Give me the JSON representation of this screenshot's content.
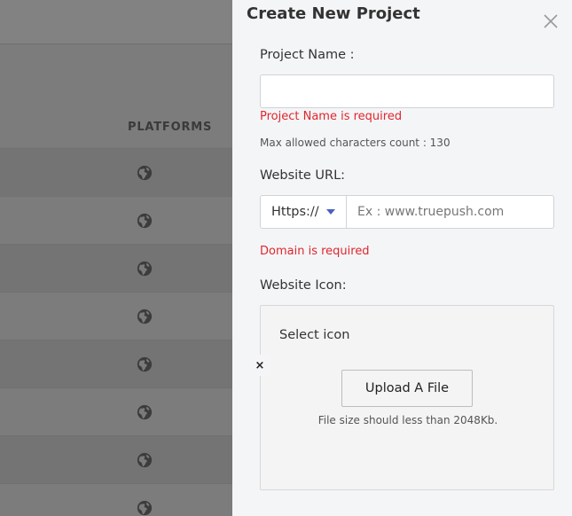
{
  "background": {
    "column_title": "PLATFORMS",
    "rows": 8,
    "row_icon": "globe-icon"
  },
  "drawer": {
    "title": "Create New Project",
    "close_icon": "close-icon",
    "project_name": {
      "label": "Project Name :",
      "value": "",
      "error": "Project Name is required",
      "hint": "Max allowed characters count : 130"
    },
    "website_url": {
      "label": "Website URL:",
      "protocol": "Https://",
      "placeholder": "Ex : www.truepush.com",
      "error": "Domain is required"
    },
    "website_icon": {
      "label": "Website Icon:",
      "select_text": "Select icon",
      "upload_label": "Upload A File",
      "size_hint": "File size should less than 2048Kb."
    },
    "dismiss_symbol": "×"
  },
  "colors": {
    "error": "#e0262d",
    "caret": "#4a5fc1",
    "drawer_bg": "#f4f5f7"
  }
}
